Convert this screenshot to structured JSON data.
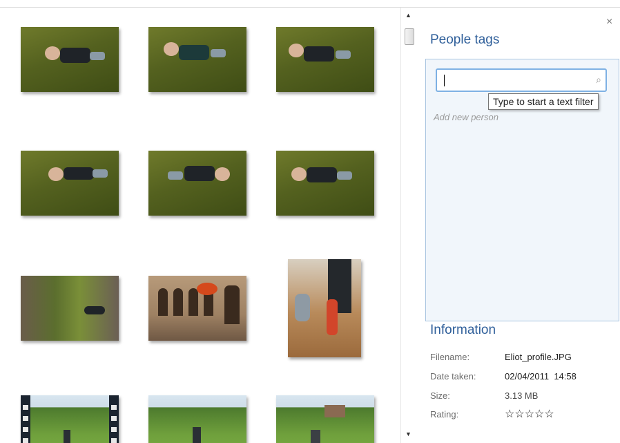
{
  "pane": {
    "close_glyph": "×",
    "people_tags_title": "People tags",
    "search_placeholder": "",
    "search_value": "",
    "search_icon": "⌕",
    "tooltip": "Type to start a text filter",
    "add_person_hint": "Add new person"
  },
  "information": {
    "title": "Information",
    "rows": [
      {
        "label": "Filename:",
        "value": "Eliot_profile.JPG"
      },
      {
        "label": "Date taken:",
        "value": "02/04/2011  14:58"
      },
      {
        "label": "Size:",
        "value": "3.13 MB"
      },
      {
        "label": "Rating:",
        "value": "☆☆☆☆☆"
      }
    ],
    "rating_stars": 0
  },
  "scroll": {
    "up_glyph": "▲",
    "down_glyph": "▼"
  },
  "colors": {
    "accent_title": "#2f5f9a",
    "panel_bg": "#f1f6fb",
    "panel_border": "#a8c4e0",
    "star": "#8fb6e3"
  },
  "thumbnails": [
    {
      "kind": "photo",
      "subject": "toddler-on-grass"
    },
    {
      "kind": "photo",
      "subject": "toddler-on-grass"
    },
    {
      "kind": "photo",
      "subject": "toddler-on-grass"
    },
    {
      "kind": "photo",
      "subject": "toddler-on-grass"
    },
    {
      "kind": "photo",
      "subject": "toddler-on-grass"
    },
    {
      "kind": "photo",
      "subject": "toddler-on-grass"
    },
    {
      "kind": "photo",
      "subject": "garden-steps"
    },
    {
      "kind": "photo",
      "subject": "stone-arches-flowers"
    },
    {
      "kind": "photo",
      "subject": "toddler-indoors"
    },
    {
      "kind": "video",
      "subject": "field-with-trees"
    },
    {
      "kind": "photo",
      "subject": "field-with-trees"
    },
    {
      "kind": "photo",
      "subject": "field-with-trees"
    }
  ]
}
